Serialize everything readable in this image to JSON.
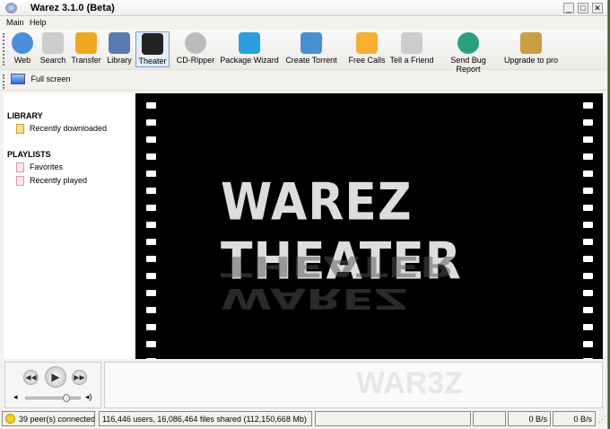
{
  "window": {
    "title": "Warez 3.1.0 (Beta)",
    "minimize": "_",
    "maximize": "□",
    "close": "✕"
  },
  "menu": [
    "Main",
    "Help"
  ],
  "toolbar": [
    {
      "label": "Web",
      "icon": "globe-icon",
      "color": "#4a8fd8"
    },
    {
      "label": "Search",
      "icon": "magnifier-icon",
      "color": "#ccc"
    },
    {
      "label": "Transfer",
      "icon": "transfer-icon",
      "color": "#f0a820"
    },
    {
      "label": "Library",
      "icon": "library-icon",
      "color": "#5a7bb0"
    },
    {
      "label": "Theater",
      "icon": "film-icon",
      "color": "#222"
    },
    {
      "label": "CD-Ripper",
      "icon": "cd-icon",
      "color": "#bbb"
    },
    {
      "label": "Package Wizard",
      "icon": "package-icon",
      "color": "#2a9ee0"
    },
    {
      "label": "Create Torrent",
      "icon": "wand-icon",
      "color": "#4a90d0"
    },
    {
      "label": "Free Calls",
      "icon": "phone-icon",
      "color": "#f5b030"
    },
    {
      "label": "Tell a Friend",
      "icon": "friend-icon",
      "color": "#ccc"
    },
    {
      "label": "Send Bug Report",
      "icon": "bug-report-icon",
      "color": "#2aa080"
    },
    {
      "label": "Upgrade to pro",
      "icon": "lock-icon",
      "color": "#c8a040"
    }
  ],
  "fullscreen": {
    "label": "Full screen"
  },
  "sidebar": {
    "library_heading": "LIBRARY",
    "library_items": [
      "Recently downloaded"
    ],
    "playlists_heading": "PLAYLISTS",
    "playlist_items": [
      "Favorites",
      "Recently played"
    ]
  },
  "video": {
    "title": "WAREZ THEATER"
  },
  "player": {
    "volume": 0.8,
    "prev": "◀◀",
    "play": "▶",
    "next": "▶▶"
  },
  "logo": {
    "text": "WAR3Z"
  },
  "status": {
    "peers": "39 peer(s) connected",
    "shared": "116,446 users, 16,086,464 files shared (112,150,668 Mb)",
    "down": "0 B/s",
    "up": "0 B/s"
  }
}
